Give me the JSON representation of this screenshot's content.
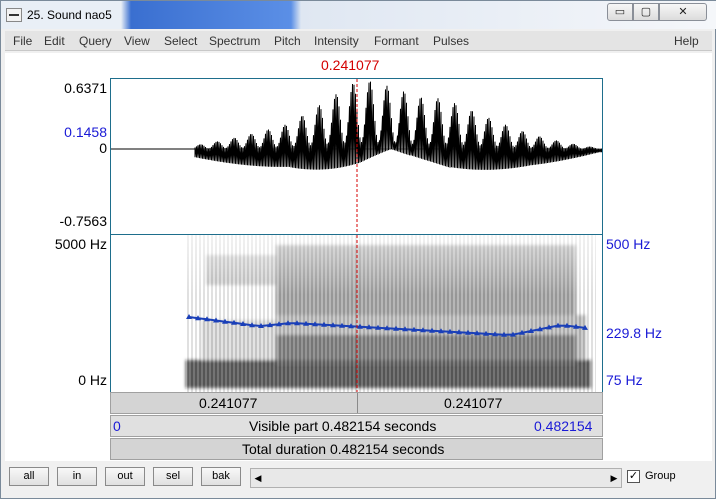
{
  "window": {
    "title": "25. Sound nao5",
    "controls": {
      "minimize": "▭",
      "maximize": "▢",
      "close": "✕"
    }
  },
  "menu": [
    "File",
    "Edit",
    "Query",
    "View",
    "Select",
    "Spectrum",
    "Pitch",
    "Intensity",
    "Formant",
    "Pulses",
    "Help"
  ],
  "cursor_time": "0.241077",
  "waveform": {
    "y_max": "0.6371",
    "y_marker": "0.1458",
    "y_zero": "0",
    "y_min": "-0.7563"
  },
  "spectrogram": {
    "freq_max": "5000 Hz",
    "freq_min": "0 Hz",
    "pitch_max": "500 Hz",
    "pitch_cursor": "229.8 Hz",
    "pitch_min": "75 Hz"
  },
  "time_bars": {
    "left_segment": "0.241077",
    "right_segment": "0.241077",
    "visible_start": "0",
    "visible_part": "Visible part 0.482154 seconds",
    "visible_end": "0.482154",
    "total_duration": "Total duration 0.482154 seconds"
  },
  "bottom": {
    "buttons": [
      "all",
      "in",
      "out",
      "sel",
      "bak"
    ],
    "group_checked": "✓",
    "group_label": "Group",
    "scroll_left": "◀",
    "scroll_right": "▶"
  },
  "colors": {
    "cursor": "#d40000",
    "axis_blue": "#1a1ad6",
    "pitch_line": "#1a3fb8",
    "frame": "#1e6e8c"
  }
}
